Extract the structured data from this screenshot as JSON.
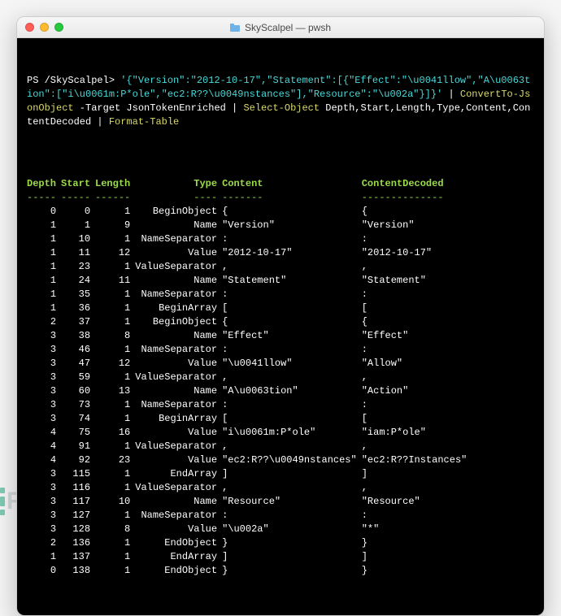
{
  "window": {
    "title": "SkyScalpel — pwsh"
  },
  "prompt": "PS /SkyScalpel>",
  "command": {
    "jsonLiteral": "'{\"Version\":\"2012-10-17\",\"Statement\":[{\"Effect\":\"\\u0041llow\",\"A\\u0063tion\":[\"i\\u0061m:P*ole\",\"ec2:R??\\u0049nstances\"],\"Resource\":\"\\u002a\"}]}'",
    "pipe1": " | ",
    "convert": "ConvertTo-JsonObject",
    "targetSwitch": " -Target ",
    "targetValue": "JsonTokenEnriched",
    "pipe2": " | ",
    "select": "Select-Object",
    "selectArgs": " Depth,Start,Length,Type,Content,ContentDecoded",
    "pipe3": " | ",
    "format": "Format-Table"
  },
  "headers": [
    "Depth",
    "Start",
    "Length",
    "Type",
    "Content",
    "ContentDecoded"
  ],
  "dashes": [
    "-----",
    "-----",
    "------",
    "----",
    "-------",
    "--------------"
  ],
  "rows": [
    {
      "d": 0,
      "s": 0,
      "l": 1,
      "t": "BeginObject",
      "c": "{",
      "cd": "{"
    },
    {
      "d": 1,
      "s": 1,
      "l": 9,
      "t": "Name",
      "c": "\"Version\"",
      "cd": "\"Version\""
    },
    {
      "d": 1,
      "s": 10,
      "l": 1,
      "t": "NameSeparator",
      "c": ":",
      "cd": ":"
    },
    {
      "d": 1,
      "s": 11,
      "l": 12,
      "t": "Value",
      "c": "\"2012-10-17\"",
      "cd": "\"2012-10-17\""
    },
    {
      "d": 1,
      "s": 23,
      "l": 1,
      "t": "ValueSeparator",
      "c": ",",
      "cd": ","
    },
    {
      "d": 1,
      "s": 24,
      "l": 11,
      "t": "Name",
      "c": "\"Statement\"",
      "cd": "\"Statement\""
    },
    {
      "d": 1,
      "s": 35,
      "l": 1,
      "t": "NameSeparator",
      "c": ":",
      "cd": ":"
    },
    {
      "d": 1,
      "s": 36,
      "l": 1,
      "t": "BeginArray",
      "c": "[",
      "cd": "["
    },
    {
      "d": 2,
      "s": 37,
      "l": 1,
      "t": "BeginObject",
      "c": "{",
      "cd": "{"
    },
    {
      "d": 3,
      "s": 38,
      "l": 8,
      "t": "Name",
      "c": "\"Effect\"",
      "cd": "\"Effect\""
    },
    {
      "d": 3,
      "s": 46,
      "l": 1,
      "t": "NameSeparator",
      "c": ":",
      "cd": ":"
    },
    {
      "d": 3,
      "s": 47,
      "l": 12,
      "t": "Value",
      "c": "\"\\u0041llow\"",
      "cd": "\"Allow\""
    },
    {
      "d": 3,
      "s": 59,
      "l": 1,
      "t": "ValueSeparator",
      "c": ",",
      "cd": ","
    },
    {
      "d": 3,
      "s": 60,
      "l": 13,
      "t": "Name",
      "c": "\"A\\u0063tion\"",
      "cd": "\"Action\""
    },
    {
      "d": 3,
      "s": 73,
      "l": 1,
      "t": "NameSeparator",
      "c": ":",
      "cd": ":"
    },
    {
      "d": 3,
      "s": 74,
      "l": 1,
      "t": "BeginArray",
      "c": "[",
      "cd": "["
    },
    {
      "d": 4,
      "s": 75,
      "l": 16,
      "t": "Value",
      "c": "\"i\\u0061m:P*ole\"",
      "cd": "\"iam:P*ole\""
    },
    {
      "d": 4,
      "s": 91,
      "l": 1,
      "t": "ValueSeparator",
      "c": ",",
      "cd": ","
    },
    {
      "d": 4,
      "s": 92,
      "l": 23,
      "t": "Value",
      "c": "\"ec2:R??\\u0049nstances\"",
      "cd": "\"ec2:R??Instances\""
    },
    {
      "d": 3,
      "s": 115,
      "l": 1,
      "t": "EndArray",
      "c": "]",
      "cd": "]"
    },
    {
      "d": 3,
      "s": 116,
      "l": 1,
      "t": "ValueSeparator",
      "c": ",",
      "cd": ","
    },
    {
      "d": 3,
      "s": 117,
      "l": 10,
      "t": "Name",
      "c": "\"Resource\"",
      "cd": "\"Resource\""
    },
    {
      "d": 3,
      "s": 127,
      "l": 1,
      "t": "NameSeparator",
      "c": ":",
      "cd": ":"
    },
    {
      "d": 3,
      "s": 128,
      "l": 8,
      "t": "Value",
      "c": "\"\\u002a\"",
      "cd": "\"*\""
    },
    {
      "d": 2,
      "s": 136,
      "l": 1,
      "t": "EndObject",
      "c": "}",
      "cd": "}"
    },
    {
      "d": 1,
      "s": 137,
      "l": 1,
      "t": "EndArray",
      "c": "]",
      "cd": "]"
    },
    {
      "d": 0,
      "s": 138,
      "l": 1,
      "t": "EndObject",
      "c": "}",
      "cd": "}"
    }
  ],
  "watermark": "REEBUF"
}
